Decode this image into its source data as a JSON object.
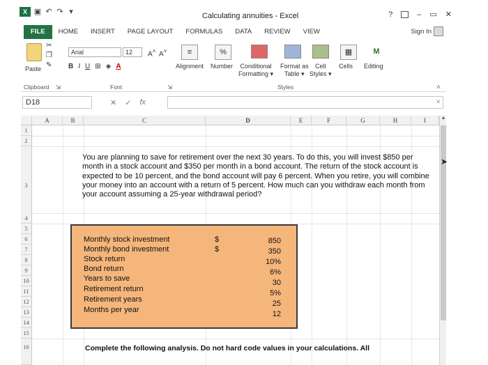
{
  "window": {
    "title": "Calculating annuities - Excel",
    "help": "?",
    "minimize": "–",
    "close": "✕"
  },
  "tabs": [
    "FILE",
    "HOME",
    "INSERT",
    "PAGE LAYOUT",
    "FORMULAS",
    "DATA",
    "REVIEW",
    "VIEW"
  ],
  "sign_in": "Sign In",
  "ribbon": {
    "paste": "Paste",
    "clipboard": "Clipboard",
    "font_name": "Arial",
    "font_size": "12",
    "bold": "B",
    "italic": "I",
    "underline": "U",
    "font_group": "Font",
    "alignment": "Alignment",
    "number": "Number",
    "percent": "%",
    "conditional_formatting": [
      "Conditional",
      "Formatting"
    ],
    "format_as_table": [
      "Format as",
      "Table"
    ],
    "cell_styles": [
      "Cell",
      "Styles"
    ],
    "styles_group": "Styles",
    "cells": "Cells",
    "editing": "Editing"
  },
  "formula_bar": {
    "name_box": "D18",
    "fx": "fx",
    "cancel": "✕",
    "enter": "✓",
    "formula": ""
  },
  "columns": [
    "A",
    "B",
    "C",
    "D",
    "E",
    "F",
    "G",
    "H",
    "I"
  ],
  "rows": [
    "1",
    "2",
    "3",
    "4",
    "5",
    "6",
    "7",
    "8",
    "9",
    "10",
    "11",
    "12",
    "13",
    "14",
    "15",
    "16"
  ],
  "question": "You are planning to save for retirement over the next 30 years. To do this, you will invest $850 per month in a stock account and $350 per month in a bond account. The return of the stock account is expected to be 10 percent, and the bond account will pay 6 percent. When you retire, you will combine your money into an account with a return of 5 percent. How much can you withdraw each month from your account assuming a 25-year withdrawal period?",
  "inputs": [
    {
      "label": "Monthly stock investment",
      "currency": "$",
      "value": "850"
    },
    {
      "label": "Monthly bond investment",
      "currency": "$",
      "value": "350"
    },
    {
      "label": "Stock return",
      "currency": "",
      "value": "10%"
    },
    {
      "label": "Bond return",
      "currency": "",
      "value": "6%"
    },
    {
      "label": "Years to save",
      "currency": "",
      "value": "30"
    },
    {
      "label": "Retirement return",
      "currency": "",
      "value": "5%"
    },
    {
      "label": "Retirement years",
      "currency": "",
      "value": "25"
    },
    {
      "label": "Months per year",
      "currency": "",
      "value": "12"
    }
  ],
  "instructions": "Complete the following analysis. Do not hard code values in your calculations. All",
  "colors": {
    "file_tab": "#217346",
    "input_fill": "#f5b67c"
  }
}
